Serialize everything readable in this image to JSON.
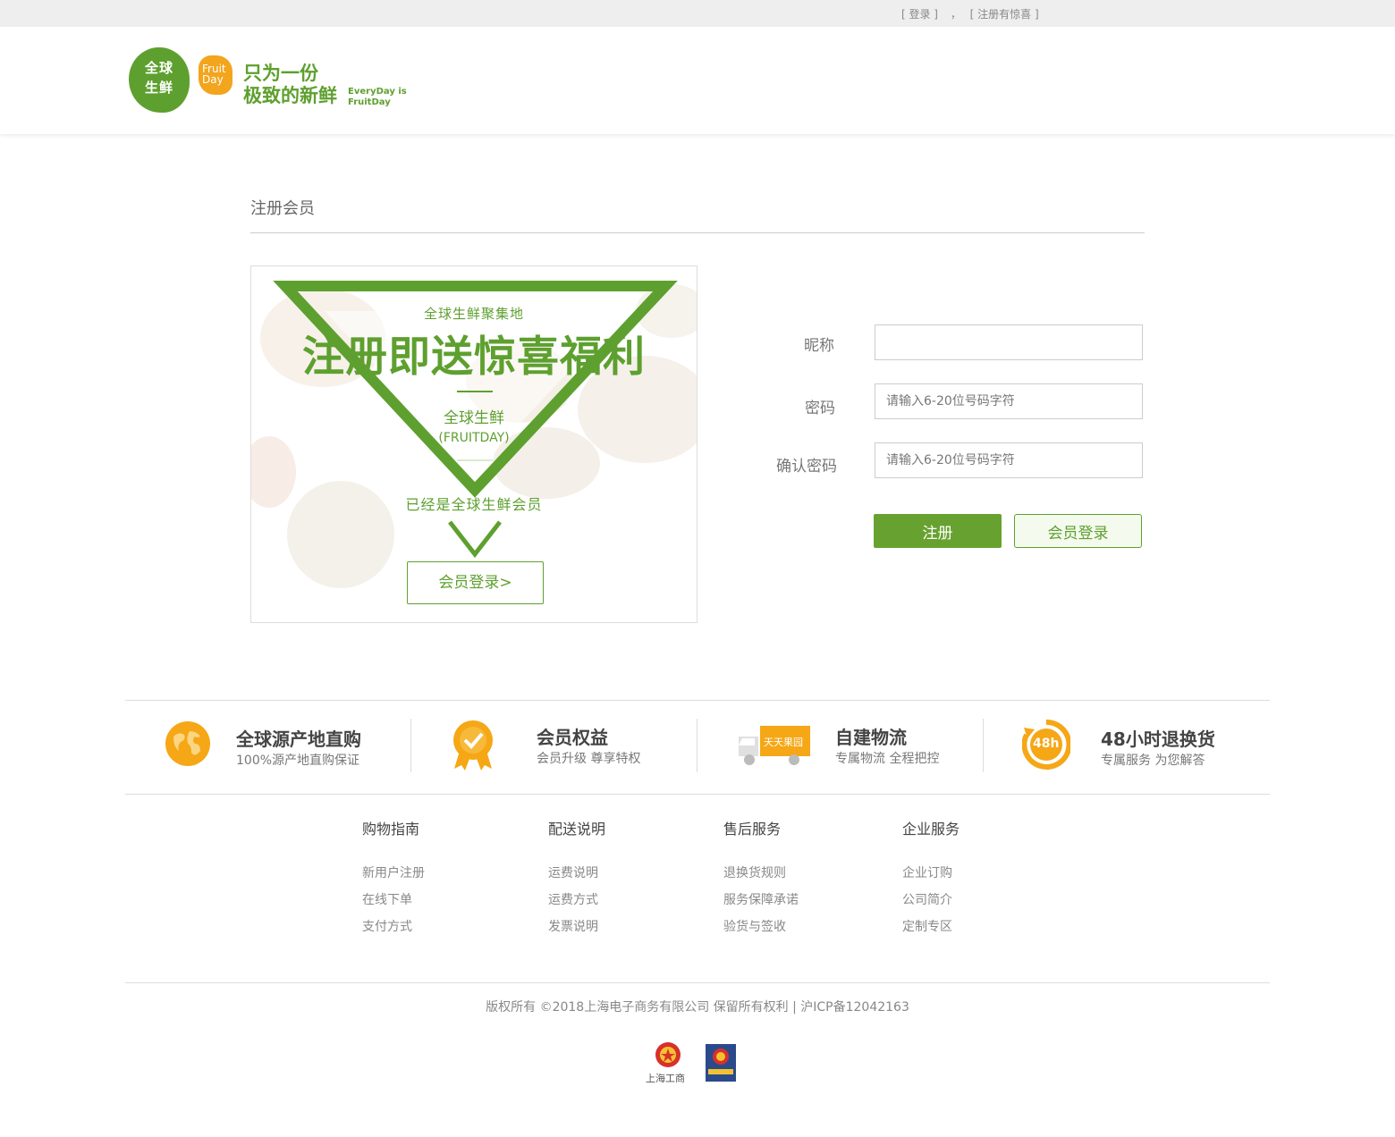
{
  "topbar": {
    "login": "[ 登录 ]",
    "separator": "，",
    "register": "[ 注册有惊喜 ]"
  },
  "header": {
    "logo_line1": "全球",
    "logo_line2": "生鲜",
    "fruit_line1": "Fruit",
    "fruit_line2": "Day",
    "slogan_line1": "只为一份",
    "slogan_line2": "极致的新鲜",
    "slogan_en1": "EveryDay is",
    "slogan_en2": "FruitDay"
  },
  "register": {
    "title": "注册会员",
    "promo": {
      "sub": "全球生鲜聚集地",
      "headline": "注册即送惊喜福利",
      "brand": "全球生鲜",
      "brand_en": "(FRUITDAY)",
      "member": "已经是全球生鲜会员",
      "login_button": "会员登录>"
    },
    "form": {
      "nickname_label": "昵称",
      "password_label": "密码",
      "password_placeholder": "请输入6-20位号码字符",
      "confirm_label": "确认密码",
      "confirm_placeholder": "请输入6-20位号码字符",
      "submit": "注册",
      "member_login": "会员登录"
    }
  },
  "services": [
    {
      "title": "全球源产地直购",
      "desc": "100%源产地直购保证",
      "icon": "globe-icon"
    },
    {
      "title": "会员权益",
      "desc": "会员升级 尊享特权",
      "icon": "badge-icon"
    },
    {
      "title": "自建物流",
      "desc": "专属物流 全程把控",
      "icon": "truck-icon",
      "truck_text": "天天果园"
    },
    {
      "title": "48小时退换货",
      "desc": "专属服务 为您解答",
      "icon": "refresh-48h-icon",
      "icon_text": "48h"
    }
  ],
  "footer": {
    "columns": [
      {
        "heading": "购物指南",
        "links": [
          "新用户注册",
          "在线下单",
          "支付方式"
        ]
      },
      {
        "heading": "配送说明",
        "links": [
          "运费说明",
          "运费方式",
          "发票说明"
        ]
      },
      {
        "heading": "售后服务",
        "links": [
          "退换货规则",
          "服务保障承诺",
          "验货与签收"
        ]
      },
      {
        "heading": "企业服务",
        "links": [
          "企业订购",
          "公司简介",
          "定制专区"
        ]
      }
    ],
    "copyright": "版权所有 ©2018上海电子商务有限公司  保留所有权利 | 沪ICP备12042163",
    "badge_label": "上海工商"
  },
  "colors": {
    "brand_green": "#5ea02f",
    "orange": "#f2a51d"
  }
}
